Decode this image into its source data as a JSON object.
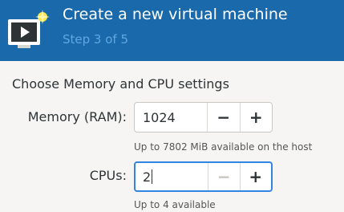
{
  "header": {
    "title": "Create a new virtual machine",
    "step": "Step 3 of 5",
    "icon": "monitor-play-icon"
  },
  "section": {
    "title": "Choose Memory and CPU settings"
  },
  "memory": {
    "label": "Memory (RAM):",
    "value": "1024",
    "decrement_label": "−",
    "increment_label": "+",
    "hint": "Up to 7802 MiB available on the host"
  },
  "cpus": {
    "label": "CPUs:",
    "value": "2",
    "decrement_label": "−",
    "increment_label": "+",
    "hint": "Up to 4 available"
  },
  "colors": {
    "header_bg": "#1a69ab",
    "step_text": "#5ea7e2",
    "focus_border": "#3584e4",
    "background": "#f6f5f4"
  }
}
